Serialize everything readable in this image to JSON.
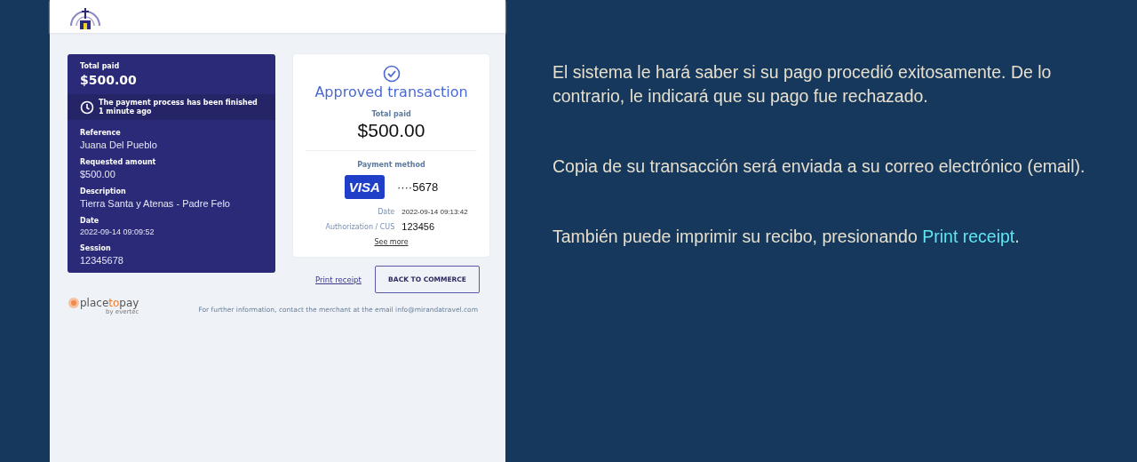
{
  "summary": {
    "total_label": "Total paid",
    "total": "$500.00",
    "notice": "The payment process has been finished 1 minute ago",
    "fields": [
      {
        "label": "Reference",
        "value": "Juana Del Pueblo",
        "kind": "text"
      },
      {
        "label": "Requested amount",
        "value": "$500.00",
        "kind": "text"
      },
      {
        "label": "Description",
        "value": "Tierra Santa y Atenas - Padre Felo",
        "kind": "text"
      },
      {
        "label": "Date",
        "value": "2022-09-14 09:09:52",
        "kind": "small"
      },
      {
        "label": "Session",
        "value": "12345678",
        "kind": "text"
      }
    ]
  },
  "result": {
    "title": "Approved transaction",
    "total_label": "Total paid",
    "total": "$500.00",
    "method_label": "Payment method",
    "card_brand": "VISA",
    "card_number": "····5678",
    "details": [
      {
        "label": "Date",
        "value": "2022-09-14 09:13:42",
        "kind": "small"
      },
      {
        "label": "Authorization / CUS",
        "value": "123456",
        "kind": "text"
      }
    ],
    "see_more": "See more"
  },
  "actions": {
    "print": "Print receipt",
    "back": "BACK TO COMMERCE"
  },
  "footer": {
    "brand": [
      "place",
      "to",
      "pay"
    ],
    "byline": "by evertec",
    "contact": "For further information, contact the merchant at the email info@mirandatravel.com"
  },
  "instructions": [
    {
      "text": "El sistema le hará saber si su pago procedió exitosamente. De lo contrario, le indicará que su pago fue rechazado."
    },
    {
      "text": "Copia de su transacción será enviada a su correo electrónico (email)."
    },
    {
      "text": "También puede imprimir su recibo, presionando",
      "link": "Print receipt",
      "after": "."
    }
  ]
}
